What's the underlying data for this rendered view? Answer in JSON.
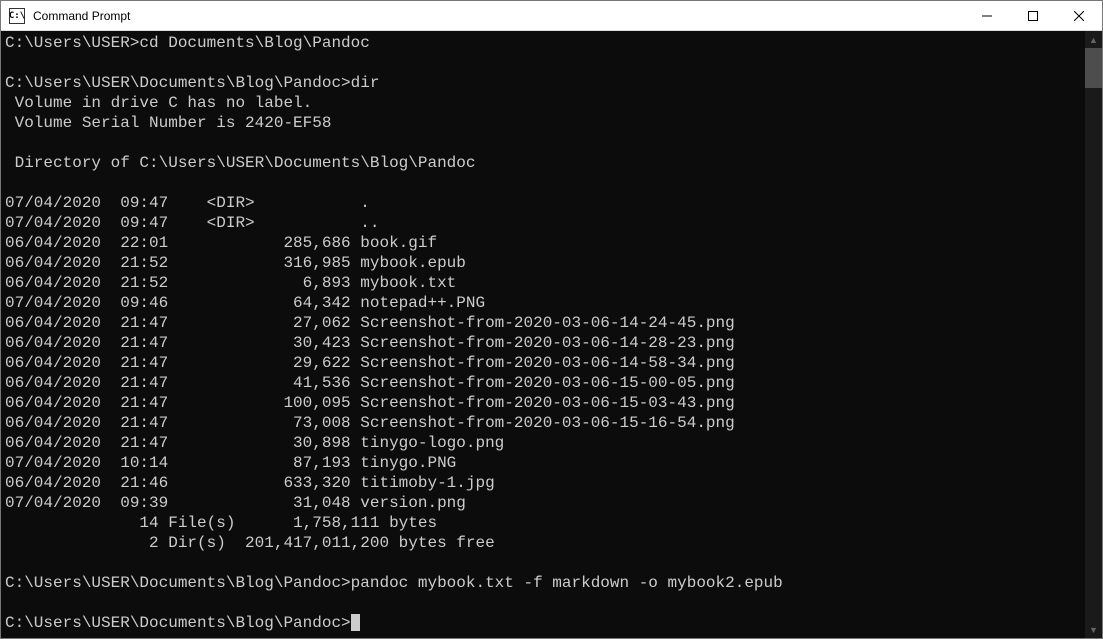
{
  "window": {
    "title": "Command Prompt",
    "icon_label": "C:\\"
  },
  "prompts": {
    "p1_path": "C:\\Users\\USER>",
    "p1_cmd": "cd Documents\\Blog\\Pandoc",
    "p2_path": "C:\\Users\\USER\\Documents\\Blog\\Pandoc>",
    "p2_cmd": "dir",
    "p3_path": "C:\\Users\\USER\\Documents\\Blog\\Pandoc>",
    "p3_cmd": "pandoc mybook.txt -f markdown -o mybook2.epub",
    "p4_path": "C:\\Users\\USER\\Documents\\Blog\\Pandoc>"
  },
  "dir_output": {
    "vol_line": " Volume in drive C has no label.",
    "serial_line": " Volume Serial Number is 2420-EF58",
    "dir_of_line": " Directory of C:\\Users\\USER\\Documents\\Blog\\Pandoc",
    "entries": [
      {
        "date": "07/04/2020",
        "time": "09:47",
        "dir": true,
        "size": "",
        "name": "."
      },
      {
        "date": "07/04/2020",
        "time": "09:47",
        "dir": true,
        "size": "",
        "name": ".."
      },
      {
        "date": "06/04/2020",
        "time": "22:01",
        "dir": false,
        "size": "285,686",
        "name": "book.gif"
      },
      {
        "date": "06/04/2020",
        "time": "21:52",
        "dir": false,
        "size": "316,985",
        "name": "mybook.epub"
      },
      {
        "date": "06/04/2020",
        "time": "21:52",
        "dir": false,
        "size": "6,893",
        "name": "mybook.txt"
      },
      {
        "date": "07/04/2020",
        "time": "09:46",
        "dir": false,
        "size": "64,342",
        "name": "notepad++.PNG"
      },
      {
        "date": "06/04/2020",
        "time": "21:47",
        "dir": false,
        "size": "27,062",
        "name": "Screenshot-from-2020-03-06-14-24-45.png"
      },
      {
        "date": "06/04/2020",
        "time": "21:47",
        "dir": false,
        "size": "30,423",
        "name": "Screenshot-from-2020-03-06-14-28-23.png"
      },
      {
        "date": "06/04/2020",
        "time": "21:47",
        "dir": false,
        "size": "29,622",
        "name": "Screenshot-from-2020-03-06-14-58-34.png"
      },
      {
        "date": "06/04/2020",
        "time": "21:47",
        "dir": false,
        "size": "41,536",
        "name": "Screenshot-from-2020-03-06-15-00-05.png"
      },
      {
        "date": "06/04/2020",
        "time": "21:47",
        "dir": false,
        "size": "100,095",
        "name": "Screenshot-from-2020-03-06-15-03-43.png"
      },
      {
        "date": "06/04/2020",
        "time": "21:47",
        "dir": false,
        "size": "73,008",
        "name": "Screenshot-from-2020-03-06-15-16-54.png"
      },
      {
        "date": "06/04/2020",
        "time": "21:47",
        "dir": false,
        "size": "30,898",
        "name": "tinygo-logo.png"
      },
      {
        "date": "07/04/2020",
        "time": "10:14",
        "dir": false,
        "size": "87,193",
        "name": "tinygo.PNG"
      },
      {
        "date": "06/04/2020",
        "time": "21:46",
        "dir": false,
        "size": "633,320",
        "name": "titimoby-1.jpg"
      },
      {
        "date": "07/04/2020",
        "time": "09:39",
        "dir": false,
        "size": "31,048",
        "name": "version.png"
      }
    ],
    "summary_files": "              14 File(s)      1,758,111 bytes",
    "summary_dirs": "               2 Dir(s)  201,417,011,200 bytes free"
  }
}
